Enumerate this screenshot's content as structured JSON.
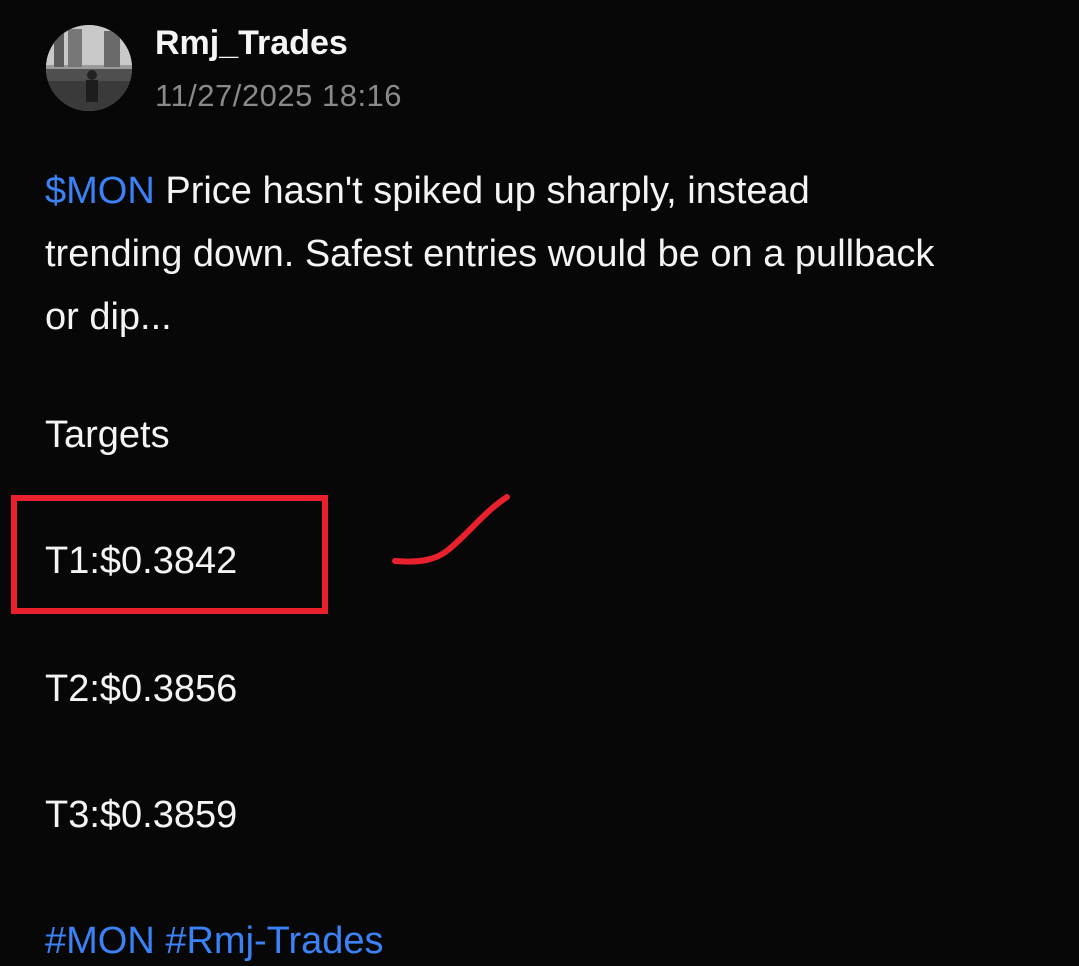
{
  "post": {
    "author": {
      "username": "Rmj_Trades",
      "avatar": "avatar-photo"
    },
    "timestamp": "11/27/2025 18:16",
    "ticker": "$MON",
    "body_rest": " Price hasn't spiked up sharply, instead trending down. Safest entries would be on a pullback or dip...",
    "targets_heading": "Targets",
    "targets": [
      "T1:$0.3842",
      "T2:$0.3856",
      "T3:$0.3859"
    ],
    "hashtags": [
      "#MON",
      "#Rmj-Trades"
    ]
  },
  "annotation": {
    "color": "#e8212c",
    "highlight": "T1"
  }
}
